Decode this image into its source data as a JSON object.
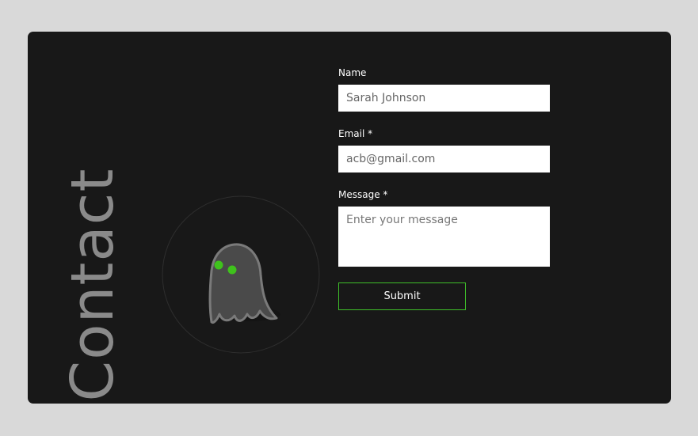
{
  "section": {
    "title": "Contact"
  },
  "illustration": {
    "icon": "ghost-icon",
    "eye_color": "#3fc21c",
    "ring_color": "#2e2e2e"
  },
  "form": {
    "name": {
      "label": "Name",
      "value": "Sarah Johnson"
    },
    "email": {
      "label": "Email *",
      "value": "acb@gmail.com"
    },
    "message": {
      "label": "Message *",
      "placeholder": "Enter your message",
      "value": ""
    },
    "submit_label": "Submit"
  },
  "colors": {
    "page_background": "#d9d9d9",
    "card_background": "#181818",
    "accent": "#3fbf2a",
    "title_text": "#8a8a8a"
  }
}
